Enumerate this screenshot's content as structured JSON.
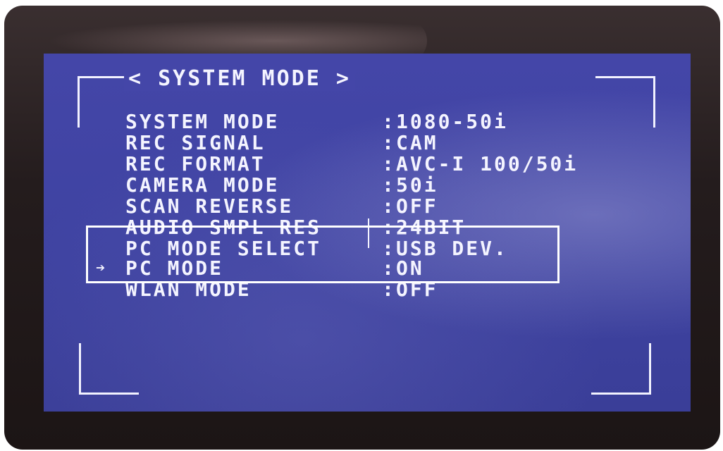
{
  "menu": {
    "title": "< SYSTEM MODE >",
    "cursor": "➔",
    "separator": ":",
    "rows": [
      {
        "label": "SYSTEM MODE",
        "value": "1080-50i"
      },
      {
        "label": "REC SIGNAL",
        "value": "CAM"
      },
      {
        "label": "REC FORMAT",
        "value": "AVC-I 100/50i"
      },
      {
        "label": "CAMERA MODE",
        "value": "50i"
      },
      {
        "label": "SCAN REVERSE",
        "value": "OFF"
      },
      {
        "label": "AUDIO SMPL RES",
        "value": "24BIT"
      },
      {
        "label": "PC MODE SELECT",
        "value": "USB DEV."
      },
      {
        "label": "PC MODE",
        "value": "ON"
      },
      {
        "label": "WLAN MODE",
        "value": "OFF"
      }
    ]
  },
  "colors": {
    "screen": "#4446a8",
    "text": "#f4f4ff",
    "highlight_box": "#ffffff"
  }
}
